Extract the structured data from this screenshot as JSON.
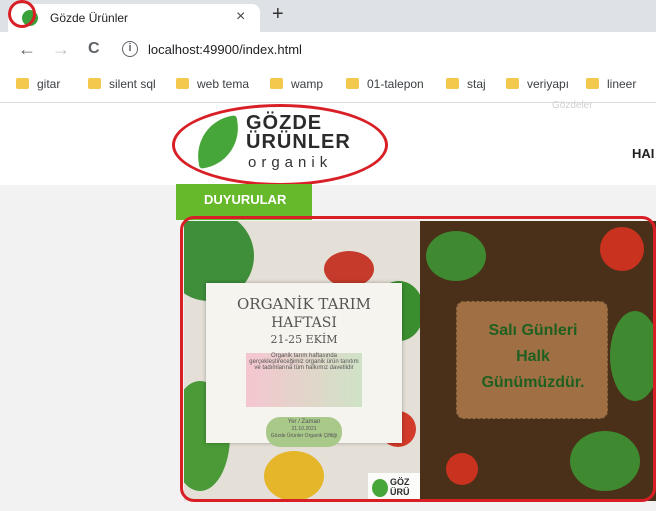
{
  "tab": {
    "title": "Gözde Ürünler",
    "close": "×",
    "new_tab": "+"
  },
  "toolbar": {
    "back": "←",
    "forward": "→",
    "reload": "C",
    "info": "i",
    "url": "localhost:49900/index.html"
  },
  "bookmarks": [
    "gitar",
    "silent sql",
    "web tema",
    "wamp",
    "01-talepon",
    "staj",
    "veriyapı",
    "lineer"
  ],
  "logo": {
    "line1": "GÖZDE",
    "line2": "ÜRÜNLER",
    "line3": "organik"
  },
  "nav": {
    "item": "HAI"
  },
  "section": {
    "title": "DUYURULAR"
  },
  "banner": {
    "poster_title1": "ORGANİK TARIM",
    "poster_title2": "HAFTASI",
    "poster_date": "21-25 EKİM",
    "poster_body": "Organik tarım haftasında gerçekleştireceğimiz organik ürün tanıtım ve tadımlarına tüm halkımız davetlidir",
    "poster_place1": "Yer / Zaman",
    "poster_place2": "21.10.2021",
    "poster_place3": "Gözde Ürünler Organik Çiftliği",
    "sign1": "Salı Günleri",
    "sign2": "Halk",
    "sign3": "Günümüzdür.",
    "watermark": "GÖZ ÜRÜ"
  },
  "faded_text": "Gözdeler",
  "colors": {
    "accent_green": "#66b92a",
    "highlight_red": "#d81f26"
  }
}
